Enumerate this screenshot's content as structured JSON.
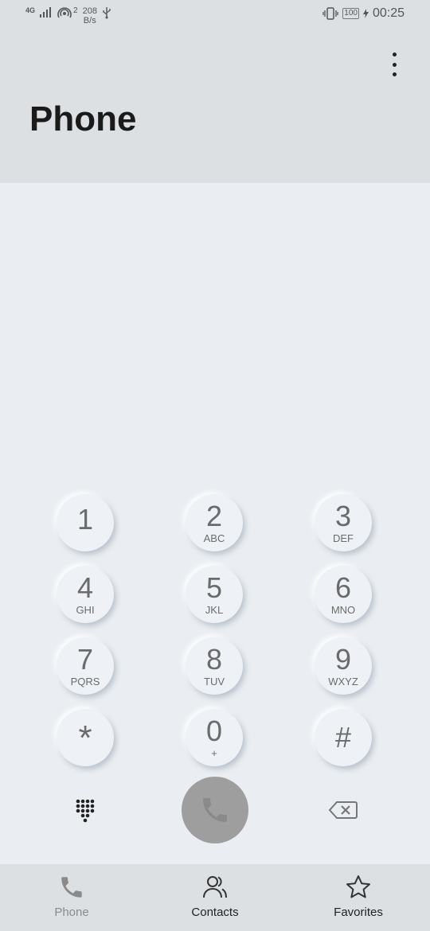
{
  "status_bar": {
    "network": "4G",
    "hotspot_count": "2",
    "speed_value": "208",
    "speed_unit": "B/s",
    "battery": "100",
    "time": "00:25"
  },
  "header": {
    "title": "Phone"
  },
  "keypad": [
    {
      "digit": "1",
      "letters": ""
    },
    {
      "digit": "2",
      "letters": "ABC"
    },
    {
      "digit": "3",
      "letters": "DEF"
    },
    {
      "digit": "4",
      "letters": "GHI"
    },
    {
      "digit": "5",
      "letters": "JKL"
    },
    {
      "digit": "6",
      "letters": "MNO"
    },
    {
      "digit": "7",
      "letters": "PQRS"
    },
    {
      "digit": "8",
      "letters": "TUV"
    },
    {
      "digit": "9",
      "letters": "WXYZ"
    },
    {
      "digit": "*",
      "letters": ""
    },
    {
      "digit": "0",
      "letters": "+"
    },
    {
      "digit": "#",
      "letters": ""
    }
  ],
  "bottom_nav": {
    "phone": "Phone",
    "contacts": "Contacts",
    "favorites": "Favorites"
  },
  "colors": {
    "call_button": "#9e9e9e",
    "background": "#eaeef2",
    "header": "#dde0e3"
  }
}
